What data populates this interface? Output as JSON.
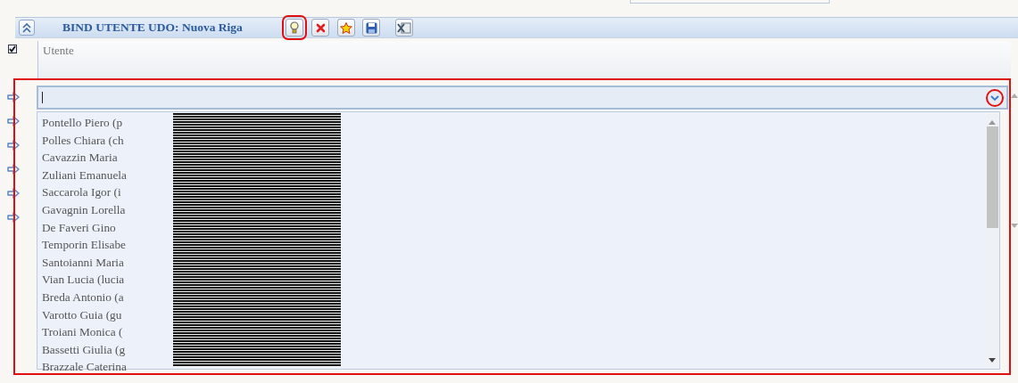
{
  "header": {
    "title": "BIND UTENTE UDO: Nuova Riga",
    "toolbar": [
      {
        "kind": "hint",
        "highlighted": true
      },
      {
        "kind": "delete",
        "highlighted": false
      },
      {
        "kind": "favorite",
        "highlighted": false
      },
      {
        "kind": "save",
        "highlighted": false
      },
      {
        "kind": "excel",
        "highlighted": false
      }
    ]
  },
  "select_all": {
    "checked": true
  },
  "column": {
    "label": "Utente"
  },
  "row_markers": [
    {
      "kind": "arrow"
    },
    {
      "kind": "arrow"
    },
    {
      "kind": "arrow"
    },
    {
      "kind": "arrow"
    },
    {
      "kind": "arrow"
    },
    {
      "kind": "arrow"
    }
  ],
  "dropdown": {
    "highlighted": true,
    "toggle_highlighted": true,
    "redacted": true,
    "options": [
      "Pontello Piero (p",
      "Polles Chiara (ch",
      "Cavazzin Maria",
      "Zuliani Emanuela",
      "Saccarola Igor (i",
      "Gavagnin Lorella",
      "De Faveri Gino",
      "Temporin Elisabe",
      "Santoianni Maria",
      "Vian Lucia (lucia",
      "Breda Antonio (a",
      "Varotto Guia (gu",
      "Troiani Monica (",
      "Bassetti Giulia (g",
      "Brazzale Caterina"
    ]
  }
}
